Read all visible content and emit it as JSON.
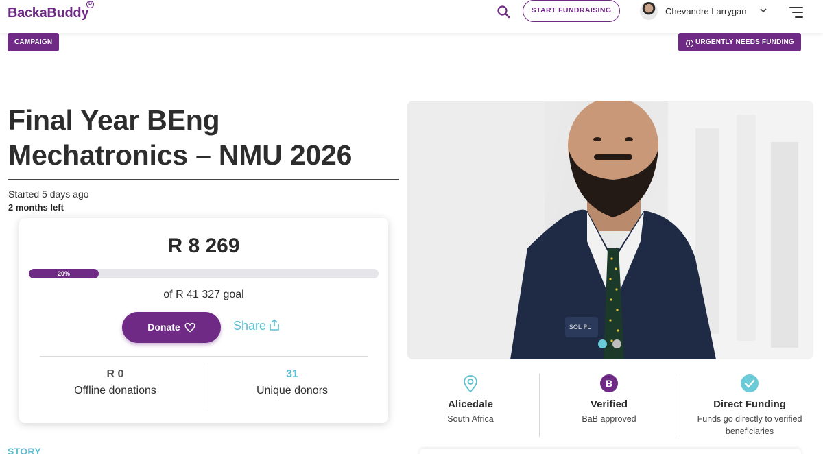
{
  "header": {
    "logo_text": "BackaBuddy",
    "logo_badge": "B",
    "start_fundraising_label": "START FUNDRAISING",
    "user_name": "Chevandre Larrygan",
    "icons": [
      "search-icon",
      "chevron-down-icon",
      "menu-icon"
    ]
  },
  "tags": {
    "campaign": "CAMPAIGN",
    "urgent": "URGENTLY NEEDS FUNDING",
    "urgent_icon": "info-icon"
  },
  "campaign": {
    "title_line1": "Final Year BEng",
    "title_line2": "Mechatronics – NMU 2026",
    "started": "Started 5 days ago",
    "time_left": "2 months left"
  },
  "donation": {
    "raised": "R 8 269",
    "progress_percent": 20,
    "progress_label": "20%",
    "goal": "of R 41 327 goal",
    "donate_label": "Donate",
    "share_label": "Share",
    "offline_value": "R 0",
    "offline_label": "Offline donations",
    "donors_value": "31",
    "donors_label": "Unique donors"
  },
  "story_heading": "STORY",
  "gallery": {
    "active_index": 0,
    "total": 2
  },
  "features": [
    {
      "icon": "location-pin-icon",
      "title": "Alicedale",
      "subtitle": "South Africa"
    },
    {
      "icon": "b-badge-icon",
      "badge_text": "B",
      "title": "Verified",
      "subtitle": "BaB approved"
    },
    {
      "icon": "check-circle-icon",
      "title": "Direct Funding",
      "subtitle": "Funds go directly to verified beneficiaries"
    }
  ],
  "colors": {
    "brand_purple": "#6e2a84",
    "accent_teal": "#5bbfd0",
    "progress_track": "#e6e6ea"
  }
}
